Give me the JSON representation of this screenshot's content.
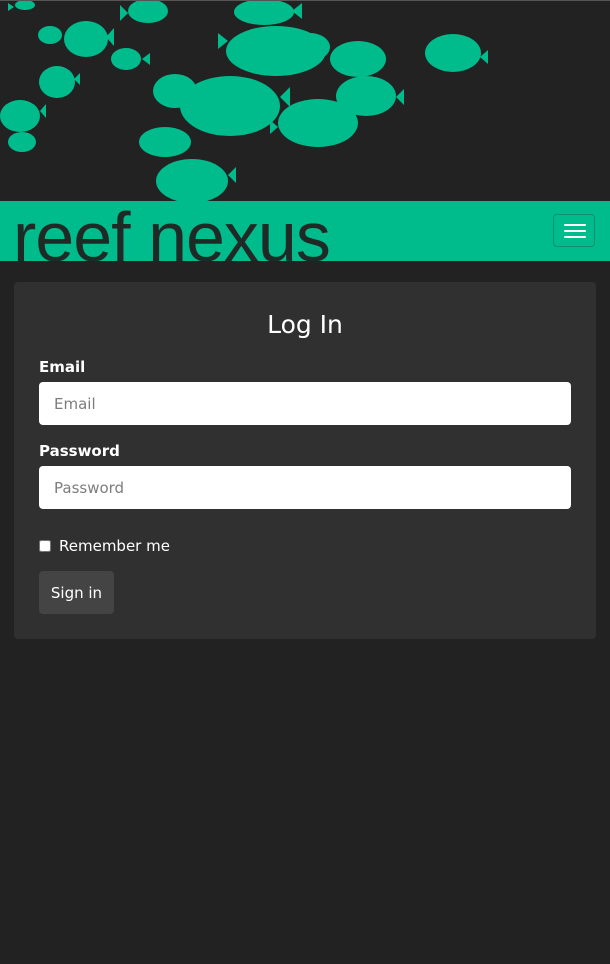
{
  "header": {
    "brand": "reef nexus",
    "brand_color": "#00bc8c",
    "menu_icon": "hamburger-menu-icon"
  },
  "login": {
    "title": "Log In",
    "email_label": "Email",
    "email_placeholder": "Email",
    "email_value": "",
    "password_label": "Password",
    "password_placeholder": "Password",
    "password_value": "",
    "remember_label": "Remember me",
    "remember_checked": false,
    "submit_label": "Sign in"
  },
  "colors": {
    "page_background": "#222222",
    "card_background": "#303030",
    "accent": "#00bc8c",
    "button_background": "#444444"
  }
}
